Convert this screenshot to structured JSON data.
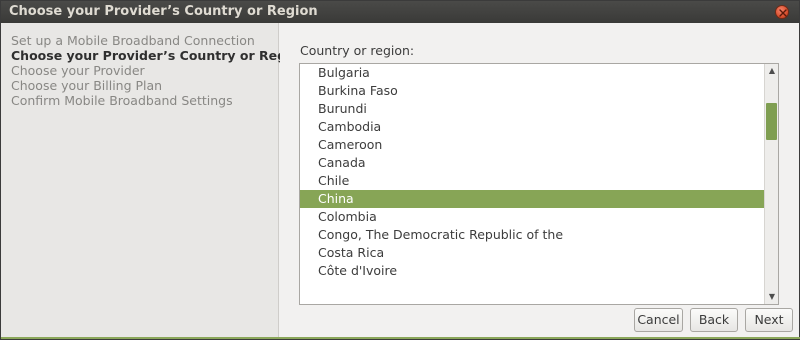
{
  "window": {
    "title": "Choose your Provider’s Country or Region"
  },
  "sidebar": {
    "steps": [
      {
        "label": "Set up a Mobile Broadband Connection",
        "active": false
      },
      {
        "label": "Choose your Provider’s Country or Region",
        "active": true
      },
      {
        "label": "Choose your Provider",
        "active": false
      },
      {
        "label": "Choose your Billing Plan",
        "active": false
      },
      {
        "label": "Confirm Mobile Broadband Settings",
        "active": false
      }
    ]
  },
  "main": {
    "field_label": "Country or region:",
    "countries": [
      "Bulgaria",
      "Burkina Faso",
      "Burundi",
      "Cambodia",
      "Cameroon",
      "Canada",
      "Chile",
      "China",
      "Colombia",
      "Congo, The Democratic Republic of the",
      "Costa Rica",
      "Côte d'Ivoire"
    ],
    "selected_country": "China"
  },
  "buttons": {
    "cancel": "Cancel",
    "back": "Back",
    "next": "Next"
  },
  "icons": {
    "close": "close-icon",
    "scroll_up": "arrow-up-icon",
    "scroll_down": "arrow-down-icon"
  },
  "colors": {
    "accent": "#87a556",
    "titlebar": "#3c3b37",
    "close_button": "#e0502f"
  }
}
